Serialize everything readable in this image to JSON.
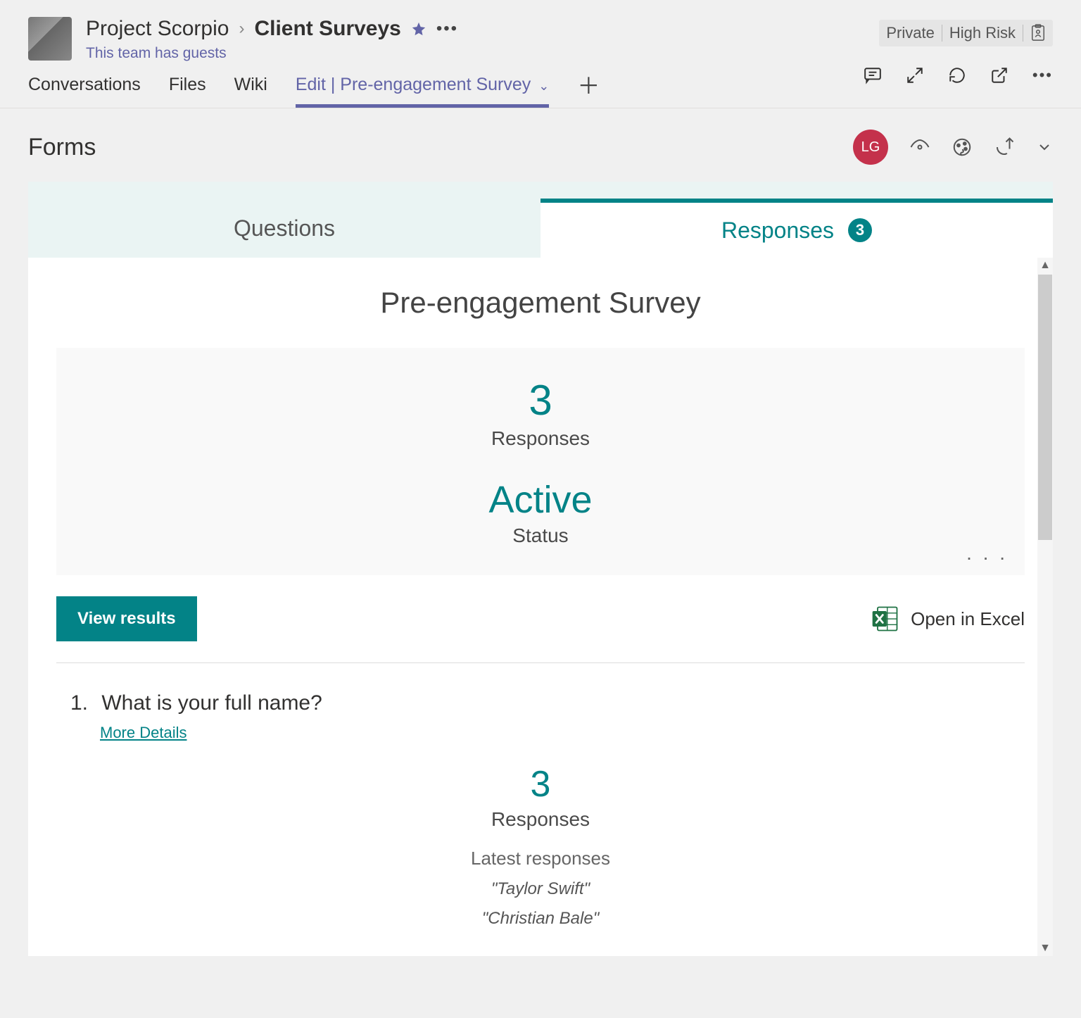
{
  "header": {
    "breadcrumb_parent": "Project Scorpio",
    "breadcrumb_current": "Client Surveys",
    "subtitle": "This team has guests",
    "tag_private": "Private",
    "tag_highrisk": "High Risk"
  },
  "channel_tabs": {
    "conversations": "Conversations",
    "files": "Files",
    "wiki": "Wiki",
    "active": "Edit | Pre-engagement Survey"
  },
  "forms_bar": {
    "title": "Forms",
    "avatar_initials": "LG"
  },
  "form_tabs": {
    "questions": "Questions",
    "responses": "Responses",
    "responses_count": "3"
  },
  "survey": {
    "title": "Pre-engagement Survey",
    "response_count": "3",
    "response_label": "Responses",
    "status_value": "Active",
    "status_label": "Status",
    "view_results": "View results",
    "open_in_excel": "Open in Excel"
  },
  "question": {
    "number": "1.",
    "text": "What is your full name?",
    "more_details": "More Details",
    "response_count": "3",
    "response_label": "Responses",
    "latest_label": "Latest responses",
    "responses": [
      "\"Taylor Swift\"",
      "\"Christian Bale\""
    ]
  }
}
